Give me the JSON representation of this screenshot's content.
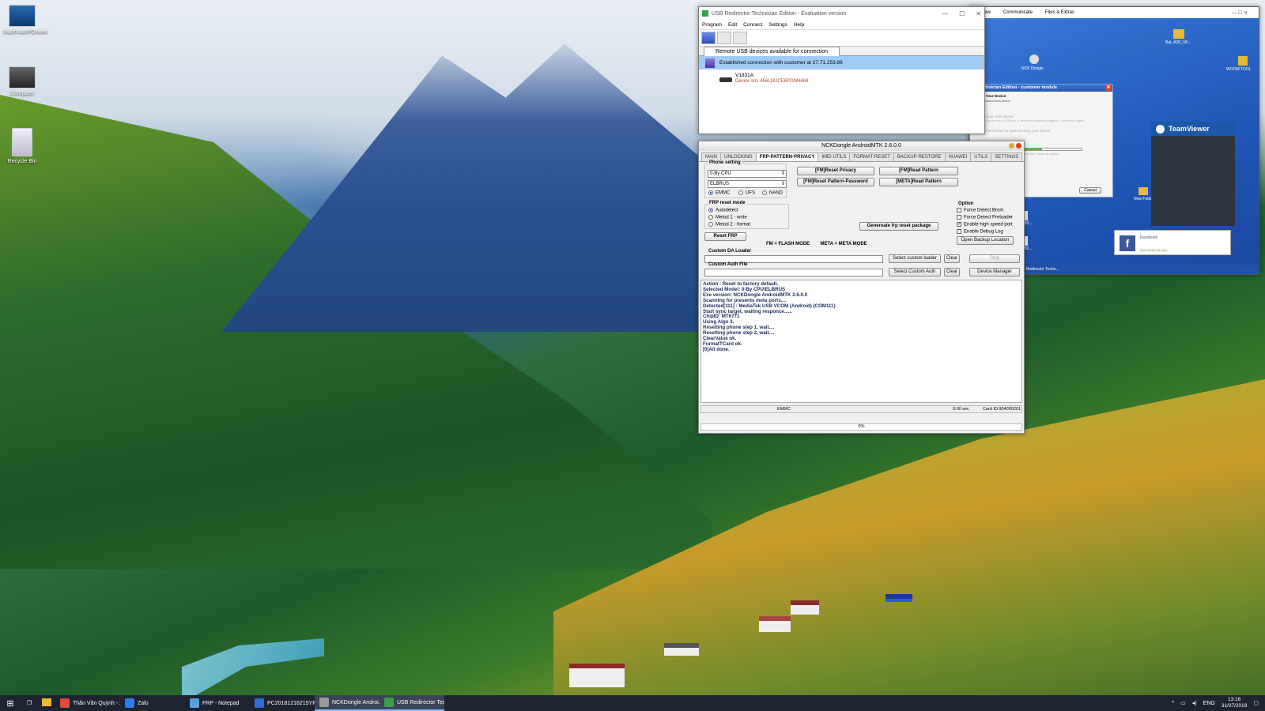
{
  "desktop": {
    "icons": [
      {
        "label": "thanhnamPDAviet"
      },
      {
        "label": "Computer"
      },
      {
        "label": "Recycle Bin"
      }
    ]
  },
  "usb_redirector": {
    "title": "USB Redirector Technician Edition - Evaluation version",
    "menu": [
      "Program",
      "Edit",
      "Connect",
      "Settings",
      "Help"
    ],
    "tab": "Remote USB devices available for connection",
    "connection": "Established connection with customer at 27.71.253.86",
    "device_name": "V1831A",
    "device_serial": "Device s/n: 456LDUCE6PONH669"
  },
  "remote": {
    "toolbar": [
      "View",
      "Communicate",
      "Files & Extras"
    ],
    "module_title": "tor Technician Edition - customer module",
    "module_lines": [
      "Share Your Device",
      "Follow instructions below",
      "Plug in your USB device",
      "Plug your device into a USB port. If the device is already plugged in, reconnect it again.",
      "Wait for technician to start servicing your device",
      "Technician is working. This may take some time. Please be patient.",
      "Service has been finished",
      "You may now unplug your device."
    ],
    "cancel": "Cancel",
    "teamviewer": "TeamViewer",
    "facebook_title": "Facebook",
    "facebook_url": "www.facebook.com",
    "taskbar_item": "USB Redirector Techn...",
    "icon_labels": [
      "Bat_A20_V8...",
      "NCK Dongle",
      "WOOM TOOL",
      "New Folder",
      "6729B0...",
      "6729B0..."
    ]
  },
  "nck": {
    "title": "NCKDongle AndroidMTK 2.6.0.0",
    "tabs": [
      "MAIN",
      "UNLOCKING",
      "FRP-PATTERN-PRIVACY",
      "IMEI UTILS",
      "FORMAT-RESET",
      "BACKUP-RESTORE",
      "HUAWEI",
      "UTILS",
      "SETTINGS"
    ],
    "active_tab": "FRP-PATTERN-PRIVACY",
    "phone_setting_label": "Phone setting",
    "cpu_select": "0-By CPU",
    "brand_select": "ELBRUS",
    "storage": [
      "EMMC",
      "UFS",
      "NAND"
    ],
    "frp_mode_label": "FRP reset mode",
    "frp_modes": [
      "Autodetect",
      "Metod 1 - write",
      "Metod 2 - format"
    ],
    "reset_frp": "Reset FRP",
    "buttons": {
      "reset_privacy": "[FM]Reset Privacy",
      "read_pattern_fm": "[FM]Read Pattern",
      "reset_pattern_password": "[FM]Reset Pattern-Password",
      "read_pattern_meta": "[META]Read Pattern",
      "generate_package": "Genereate frp reset package"
    },
    "option_label": "Option",
    "options": [
      {
        "label": "Force Detect Brom",
        "checked": false
      },
      {
        "label": "Force Detect Preloader",
        "checked": false
      },
      {
        "label": "Enable high speed port",
        "checked": true
      },
      {
        "label": "Enable Debug Log",
        "checked": false
      }
    ],
    "open_backup": "Open Backup Location",
    "mode_legend": "FM = FLASH MODE        META = META MODE",
    "custom_da_label": "Custom DA Loader",
    "custom_auth_label": "Custom Auth File",
    "select_loader": "Select custom loader",
    "select_auth": "Select Custom Auth",
    "clear": "Clear",
    "stop": "Stop",
    "device_manager": "Device Manager",
    "log": [
      "Action : Reset to factory default.",
      "Selected Model: 0-By CPU\\ELBRUS",
      "Exe version: NCKDongle AndroidMTK 2.6.0.0",
      "Scanning for presents meta ports....",
      "Detected[111] : MediaTek USB VCOM (Android) (COM111)",
      "Start sync target, waiting responce......",
      "ChipID: MT6771",
      "Using Algo 3.",
      "Resetting phone step 1, wait....",
      "Resetting phone step 2, wait....",
      "ClearValue ok.",
      "FormatTCard ok.",
      "[0]All done."
    ],
    "status_storage": "EMMC",
    "status_time": "0:00 sec",
    "status_card": "Card ID:904000201",
    "progress_text": "0%",
    "progress": 0
  },
  "taskbar": {
    "items": [
      {
        "label": "Thân Văn Quỳnh - X...",
        "color": "#e04a3a"
      },
      {
        "label": "Zalo",
        "color": "#2b7cf2"
      },
      {
        "label": "FRP - Notepad",
        "color": "#5aa0d8"
      },
      {
        "label": "PC20181216215YR...",
        "color": "#2f6fd0"
      },
      {
        "label": "NCKDongle Androi...",
        "color": "#999999"
      },
      {
        "label": "USB Redirector Tec...",
        "color": "#3aa04a"
      }
    ],
    "lang": "ENG",
    "time": "13:16",
    "date": "31/07/2019"
  }
}
